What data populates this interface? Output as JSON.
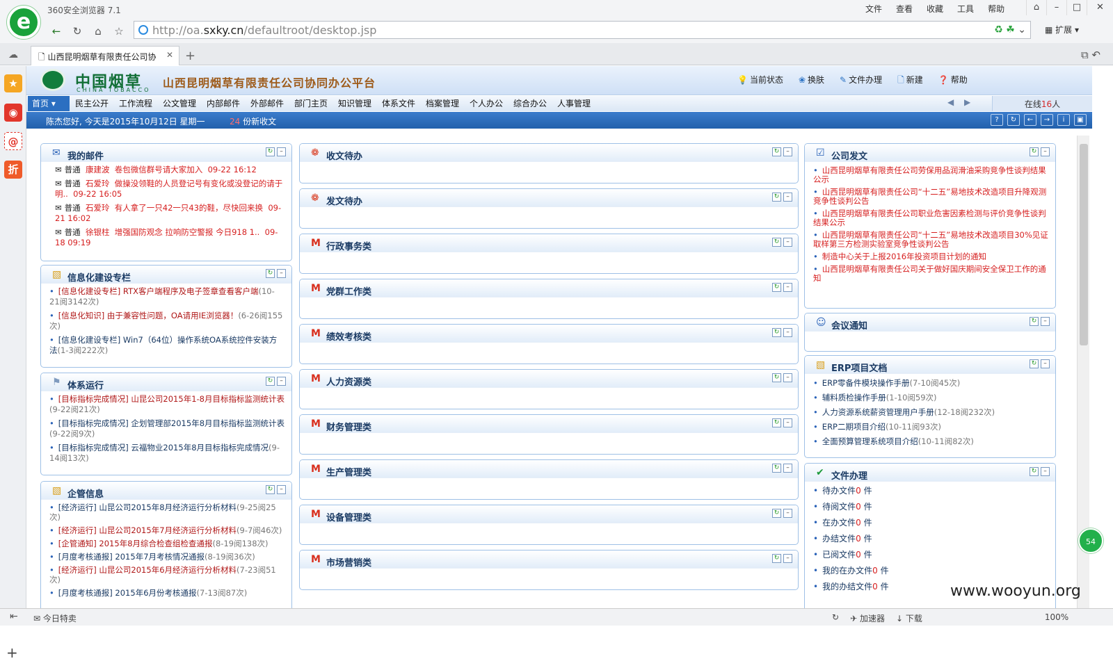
{
  "browser": {
    "app_name": "360安全浏览器 7.1",
    "menus": [
      "文件",
      "查看",
      "收藏",
      "工具",
      "帮助"
    ],
    "url_host_prefix": "http://oa.",
    "url_host": "sxky.cn",
    "url_path": "/defaultroot/desktop.jsp",
    "extend_label": "扩展",
    "tab_title": "山西昆明烟草有限责任公司协 ",
    "statusbar": {
      "today_deal": "今日特卖",
      "accelerator": "加速器",
      "download": "下载",
      "zoom": "100%"
    },
    "badge": "54",
    "watermark": "www.wooyun.org"
  },
  "oa": {
    "brand_cn": "中国烟草",
    "brand_en": "CHINA TOBACCO",
    "platform_name": "山西昆明烟草有限责任公司协同办公平台",
    "toolbar": {
      "status": "当前状态",
      "skin": "换肤",
      "file_handle": "文件办理",
      "new": "新建",
      "help": "帮助"
    },
    "nav": [
      "首页",
      "民主公开",
      "工作流程",
      "公文管理",
      "内部邮件",
      "外部邮件",
      "部门主页",
      "知识管理",
      "体系文件",
      "档案管理",
      "个人办公",
      "综合办公",
      "人事管理"
    ],
    "online_label": "在线",
    "online_count": "16",
    "online_unit": "人",
    "greeting": "陈杰您好, 今天是2015年10月12日  星期一",
    "new_docs_count": "24",
    "new_docs_label": "份新收文"
  },
  "panels": {
    "mail": {
      "title": "我的邮件",
      "items": [
        {
          "level": "普通",
          "sender": "康建波",
          "subject": "卷包微信群号请大家加入",
          "time": "09-22 16:12"
        },
        {
          "level": "普通",
          "sender": "石爱玲",
          "subject": "做操没领鞋的人员登记号有变化或没登记的请于明..",
          "time": "09-22 16:05"
        },
        {
          "level": "普通",
          "sender": "石爱玲",
          "subject": "有人拿了一只42一只43的鞋，尽快回来换",
          "time": "09-21 16:02"
        },
        {
          "level": "普通",
          "sender": "徐银柱",
          "subject": "增强国防观念 拉响防空警报 今日918 1..",
          "time": "09-18 09:19"
        }
      ]
    },
    "info": {
      "title": "信息化建设专栏",
      "items": [
        {
          "text": "[信息化建设专栏] RTX客户端程序及电子签章查看客户端",
          "meta": "(10-21阅3142次)",
          "red": true
        },
        {
          "text": "[信息化知识] 由于兼容性问题，OA请用IE浏览器！",
          "meta": "(6-26阅155次)",
          "red": true
        },
        {
          "text": "[信息化建设专栏] Win7（64位）操作系统OA系统控件安装方法",
          "meta": "(1-3阅222次)",
          "red": false
        }
      ]
    },
    "system": {
      "title": "体系运行",
      "items": [
        {
          "text": "[目标指标完成情况] 山昆公司2015年1-8月目标指标监测统计表",
          "meta": "(9-22阅21次)",
          "red": true
        },
        {
          "text": "[目标指标完成情况] 企划管理部2015年8月目标指标监测统计表",
          "meta": "(9-22阅9次)",
          "red": false
        },
        {
          "text": "[目标指标完成情况] 云福物业2015年8月目标指标完成情况",
          "meta": "(9-14阅13次)",
          "red": false
        }
      ]
    },
    "mgmt": {
      "title": "企管信息",
      "items": [
        {
          "text": "[经济运行] 山昆公司2015年8月经济运行分析材料",
          "meta": "(9-25阅25次)",
          "red": false
        },
        {
          "text": "[经济运行] 山昆公司2015年7月经济运行分析材料",
          "meta": "(9-7阅46次)",
          "red": true
        },
        {
          "text": "[企管通知] 2015年8月综合检查组检查通报",
          "meta": "(8-19阅138次)",
          "red": true
        },
        {
          "text": "[月度考核通报] 2015年7月考核情况通报",
          "meta": "(8-19阅36次)",
          "red": false
        },
        {
          "text": "[经济运行] 山昆公司2015年6月经济运行分析材料",
          "meta": "(7-23阅51次)",
          "red": true
        },
        {
          "text": "[月度考核通报] 2015年6月份考核通报",
          "meta": "(7-13阅87次)",
          "red": false
        }
      ]
    },
    "middle": [
      {
        "title": "收文待办",
        "icon": "award-icon"
      },
      {
        "title": "发文待办",
        "icon": "award-icon"
      },
      {
        "title": "行政事务类",
        "icon": "mail-icon"
      },
      {
        "title": "党群工作类",
        "icon": "mail-icon"
      },
      {
        "title": "绩效考核类",
        "icon": "mail-icon"
      },
      {
        "title": "人力资源类",
        "icon": "mail-icon"
      },
      {
        "title": "财务管理类",
        "icon": "mail-icon"
      },
      {
        "title": "生产管理类",
        "icon": "mail-icon"
      },
      {
        "title": "设备管理类",
        "icon": "mail-icon"
      },
      {
        "title": "市场营销类",
        "icon": "mail-icon"
      }
    ],
    "company_docs": {
      "title": "公司发文",
      "items": [
        "山西昆明烟草有限责任公司劳保用品润滑油采购竞争性谈判结果公示",
        "山西昆明烟草有限责任公司“十二五”易地技术改造项目升降观测竞争性谈判公告",
        "山西昆明烟草有限责任公司职业危害因素检测与评价竞争性谈判结果公示",
        "山西昆明烟草有限责任公司“十二五”易地技术改造项目30%见证取样第三方检测实验室竞争性谈判公告",
        "制造中心关于上报2016年投资项目计划的通知",
        "山西昆明烟草有限责任公司关于做好国庆期间安全保卫工作的通知"
      ]
    },
    "meeting": {
      "title": "会议通知"
    },
    "erp": {
      "title": "ERP项目文档",
      "items": [
        {
          "text": "ERP零备件模块操作手册",
          "meta": "(7-10阅45次)"
        },
        {
          "text": "辅料质检操作手册",
          "meta": "(1-10阅59次)"
        },
        {
          "text": "人力资源系统薪资管理用户手册",
          "meta": "(12-18阅232次)"
        },
        {
          "text": "ERP二期项目介绍",
          "meta": "(10-11阅93次)"
        },
        {
          "text": "全面预算管理系统项目介绍",
          "meta": "(10-11阅82次)"
        }
      ]
    },
    "file_work": {
      "title": "文件办理",
      "unit": "件",
      "items": [
        {
          "label": "待办文件",
          "count": "0"
        },
        {
          "label": "待阅文件",
          "count": "0"
        },
        {
          "label": "在办文件",
          "count": "0"
        },
        {
          "label": "办结文件",
          "count": "0"
        },
        {
          "label": "已阅文件",
          "count": "0"
        },
        {
          "label": "我的在办文件",
          "count": "0"
        },
        {
          "label": "我的办结文件",
          "count": "0"
        }
      ]
    }
  }
}
